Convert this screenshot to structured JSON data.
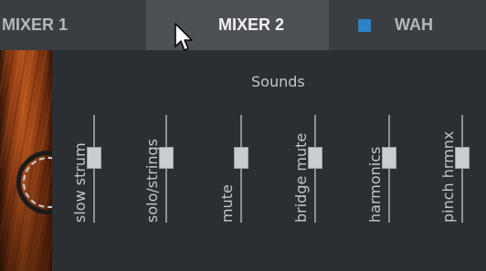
{
  "tabs": [
    {
      "label": "MIXER 1",
      "active": false
    },
    {
      "label": "MIXER 2",
      "active": true
    },
    {
      "label": "WAH",
      "active": false,
      "toggle_color": "#2a82c8"
    }
  ],
  "section": {
    "title": "Sounds"
  },
  "faders": [
    {
      "label": "slow strum",
      "level": 0.5
    },
    {
      "label": "solo/strings",
      "level": 0.5
    },
    {
      "label": "mute",
      "level": 0.5
    },
    {
      "label": "bridge mute",
      "level": 0.5
    },
    {
      "label": "harmonics",
      "level": 0.5
    },
    {
      "label": "pinch hrmnx",
      "level": 0.5
    }
  ],
  "colors": {
    "active_tab": "#4d5155",
    "background": "#2b2e32",
    "accent": "#2a82c8"
  }
}
